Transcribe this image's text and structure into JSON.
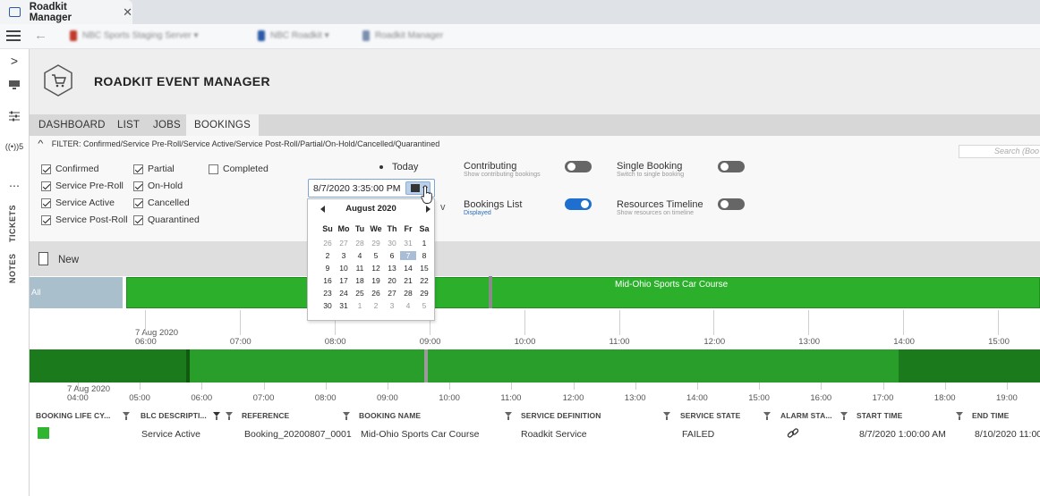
{
  "browser": {
    "tab_title": "Roadkit Manager",
    "tab_close": "✕",
    "breadcrumbs": [
      "NBC Sports Staging Server",
      "NBC Roadkit",
      "Roadkit Manager"
    ]
  },
  "rail": {
    "chevron": ">",
    "signal_count": "5",
    "more": "⋯",
    "tickets": "TICKETS",
    "notes": "NOTES"
  },
  "app": {
    "title": "ROADKIT EVENT MANAGER"
  },
  "tabs": [
    {
      "label": "DASHBOARD"
    },
    {
      "label": "LIST"
    },
    {
      "label": "JOBS"
    },
    {
      "label": "BOOKINGS",
      "active": true
    }
  ],
  "filter": {
    "text": "FILTER: Confirmed/Service Pre-Roll/Service Active/Service Post-Roll/Partial/On-Hold/Cancelled/Quarantined",
    "search_placeholder": "Search (Boo",
    "checkboxes": [
      {
        "label": "Confirmed",
        "checked": true
      },
      {
        "label": "Service Pre-Roll",
        "checked": true
      },
      {
        "label": "Service Active",
        "checked": true
      },
      {
        "label": "Service Post-Roll",
        "checked": true
      },
      {
        "label": "Partial",
        "checked": true
      },
      {
        "label": "On-Hold",
        "checked": true
      },
      {
        "label": "Cancelled",
        "checked": true
      },
      {
        "label": "Quarantined",
        "checked": true
      },
      {
        "label": "Completed",
        "checked": false
      }
    ],
    "today_label": "Today",
    "date_value": "8/7/2020 3:35:00 PM",
    "partial_glyph": "v"
  },
  "toggles": {
    "contributing": {
      "label": "Contributing",
      "sub": "Show contributing bookings",
      "on": false
    },
    "single_booking": {
      "label": "Single Booking",
      "sub": "Switch to single booking",
      "on": false
    },
    "bookings_list": {
      "label": "Bookings List",
      "sub": "Displayed",
      "on": true
    },
    "resources_timeline": {
      "label": "Resources Timeline",
      "sub": "Show resources on timeline",
      "on": false
    }
  },
  "calendar": {
    "month_label": "August 2020",
    "weekdays": [
      "Su",
      "Mo",
      "Tu",
      "We",
      "Th",
      "Fr",
      "Sa"
    ],
    "weeks": [
      [
        "26",
        "27",
        "28",
        "29",
        "30",
        "31",
        "1"
      ],
      [
        "2",
        "3",
        "4",
        "5",
        "6",
        "7",
        "8"
      ],
      [
        "9",
        "10",
        "11",
        "12",
        "13",
        "14",
        "15"
      ],
      [
        "16",
        "17",
        "18",
        "19",
        "20",
        "21",
        "22"
      ],
      [
        "23",
        "24",
        "25",
        "26",
        "27",
        "28",
        "29"
      ],
      [
        "30",
        "31",
        "1",
        "2",
        "3",
        "4",
        "5"
      ]
    ],
    "selected": "7"
  },
  "new_label": "New",
  "timeline": {
    "all_label": "All",
    "event_title": "Mid-Ohio Sports Car Course",
    "axis1": {
      "date": "7 Aug 2020",
      "hours": [
        "06:00",
        "07:00",
        "08:00",
        "09:00",
        "10:00",
        "11:00",
        "12:00",
        "13:00",
        "14:00",
        "15:00"
      ]
    },
    "axis2": {
      "date": "7 Aug 2020",
      "hours": [
        "04:00",
        "05:00",
        "06:00",
        "07:00",
        "08:00",
        "09:00",
        "10:00",
        "11:00",
        "12:00",
        "13:00",
        "14:00",
        "15:00",
        "16:00",
        "17:00",
        "18:00",
        "19:00"
      ]
    }
  },
  "table": {
    "columns": [
      "BOOKING LIFE CY...",
      "BLC DESCRIPTI...",
      "REFERENCE",
      "BOOKING NAME",
      "SERVICE DEFINITION",
      "SERVICE STATE",
      "ALARM STA...",
      "START TIME",
      "END TIME"
    ],
    "rows": [
      {
        "blc_description": "Service Active",
        "reference": "Booking_20200807_0001",
        "booking_name": "Mid-Ohio Sports Car Course",
        "service_definition": "Roadkit Service",
        "service_state": "FAILED",
        "start_time": "8/7/2020 1:00:00 AM",
        "end_time": "8/10/2020 11:00"
      }
    ]
  },
  "colors": {
    "event_green": "#2cb02c",
    "band_green": "#2a9e2a",
    "band_dark_green": "#1b7a1b",
    "toggle_on": "#1f6fd0",
    "all_label_bg": "#aabfcc"
  }
}
